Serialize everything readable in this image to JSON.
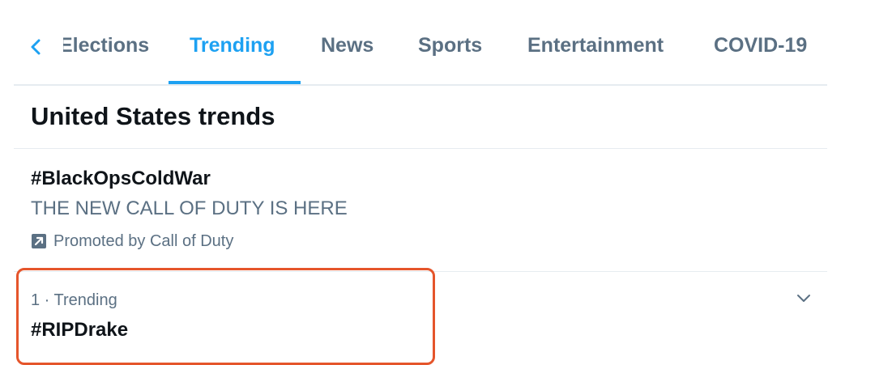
{
  "tabs": [
    {
      "label": "Elections"
    },
    {
      "label": "Trending",
      "active": true
    },
    {
      "label": "News"
    },
    {
      "label": "Sports"
    },
    {
      "label": "Entertainment"
    },
    {
      "label": "COVID-19"
    }
  ],
  "section": {
    "title": "United States trends"
  },
  "trends": [
    {
      "name": "#BlackOpsColdWar",
      "description": "THE NEW CALL OF DUTY IS HERE",
      "promoted_text": "Promoted by Call of Duty"
    },
    {
      "meta": "1 · Trending",
      "name": "#RIPDrake"
    }
  ],
  "colors": {
    "accent": "#1da1f2",
    "text_primary": "#0f1419",
    "text_secondary": "#5b7083",
    "divider": "#e6ecf0",
    "highlight": "#e5552b"
  },
  "icons": {
    "back": "chevron-left-icon",
    "promoted": "promoted-arrow-icon",
    "more": "chevron-down-icon"
  }
}
